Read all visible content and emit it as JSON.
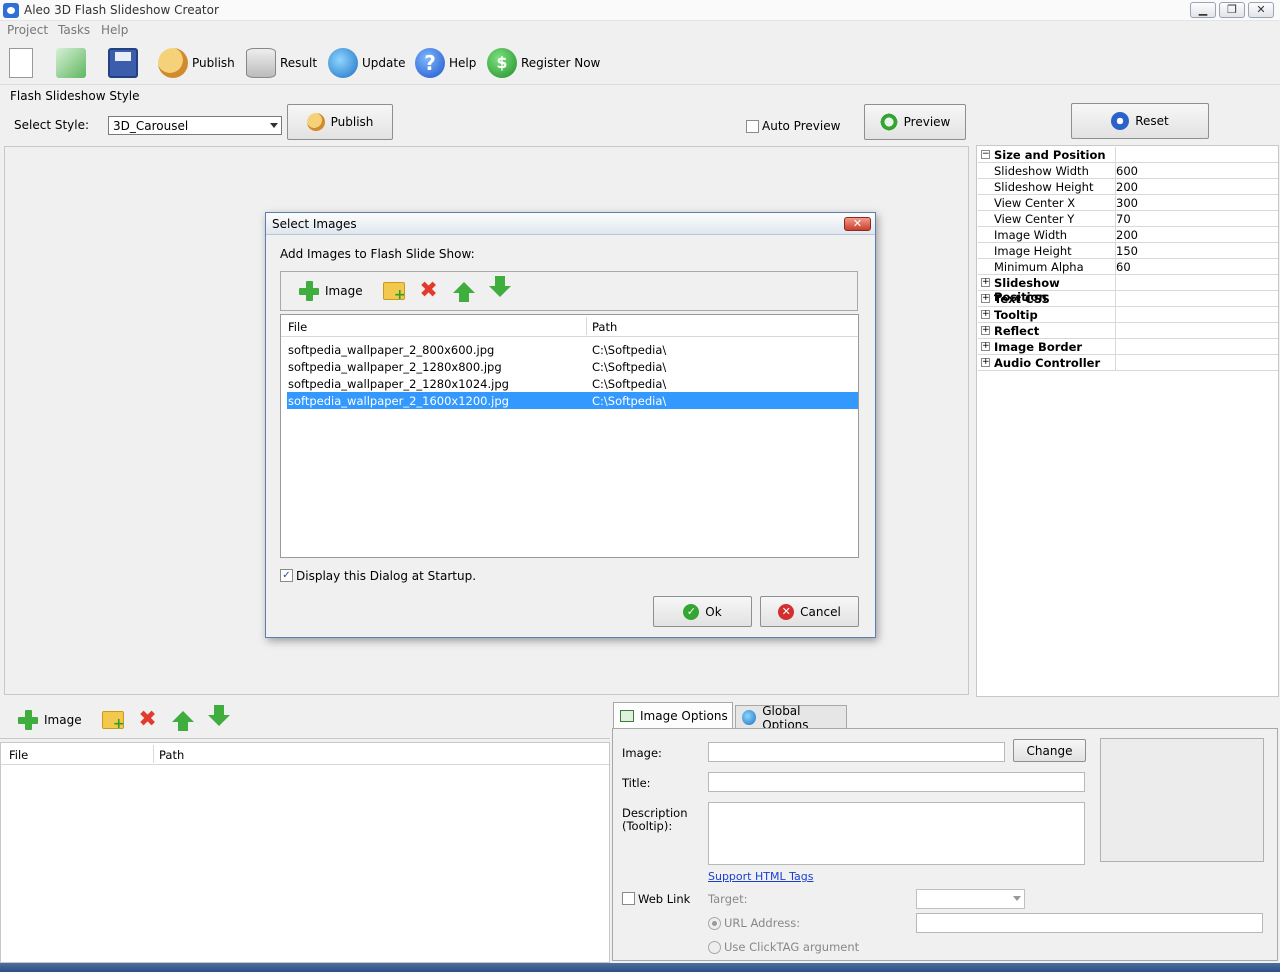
{
  "window": {
    "title": "Aleo 3D Flash Slideshow Creator",
    "min": "▁",
    "max": "❐",
    "close": "✕"
  },
  "menu": [
    "Project",
    "Tasks",
    "Help"
  ],
  "toolbar": {
    "publish": "Publish",
    "result": "Result",
    "update": "Update",
    "help": "Help",
    "register": "Register Now"
  },
  "style_section": {
    "heading": "Flash Slideshow Style",
    "select_label": "Select Style:",
    "select_value": "3D_Carousel",
    "publish_button": "Publish",
    "auto_preview": "Auto Preview",
    "preview_button": "Preview"
  },
  "properties": {
    "reset_button": "Reset",
    "groups": [
      {
        "name": "Size and Position",
        "expanded": true,
        "toggle": "−",
        "items": [
          {
            "key": "Slideshow Width",
            "value": "600"
          },
          {
            "key": "Slideshow Height",
            "value": "200"
          },
          {
            "key": "View Center X",
            "value": "300"
          },
          {
            "key": "View Center Y",
            "value": "70"
          },
          {
            "key": "Image Width",
            "value": "200"
          },
          {
            "key": "Image Height",
            "value": "150"
          },
          {
            "key": "Minimum Alpha",
            "value": "60"
          }
        ]
      },
      {
        "name": "Slideshow Position",
        "toggle": "+"
      },
      {
        "name": "Text CSS",
        "toggle": "+"
      },
      {
        "name": "Tooltip",
        "toggle": "+"
      },
      {
        "name": "Reflect",
        "toggle": "+"
      },
      {
        "name": "Image Border",
        "toggle": "+"
      },
      {
        "name": "Audio Controller",
        "toggle": "+"
      }
    ]
  },
  "dialog": {
    "title": "Select Images",
    "close": "✕",
    "instruction": "Add Images to Flash Slide Show:",
    "add_image": "Image",
    "columns": {
      "file": "File",
      "path": "Path"
    },
    "rows": [
      {
        "file": "softpedia_wallpaper_2_800x600.jpg",
        "path": "C:\\Softpedia\\"
      },
      {
        "file": "softpedia_wallpaper_2_1280x800.jpg",
        "path": "C:\\Softpedia\\"
      },
      {
        "file": "softpedia_wallpaper_2_1280x1024.jpg",
        "path": "C:\\Softpedia\\"
      },
      {
        "file": "softpedia_wallpaper_2_1600x1200.jpg",
        "path": "C:\\Softpedia\\",
        "selected": true
      }
    ],
    "startup_checkbox": "Display this Dialog at Startup.",
    "ok": "Ok",
    "cancel": "Cancel"
  },
  "bottom_left": {
    "add_image": "Image",
    "columns": {
      "file": "File",
      "path": "Path"
    }
  },
  "options": {
    "tab_image": "Image Options",
    "tab_global": "Global Options",
    "image_label": "Image:",
    "change_button": "Change",
    "title_label": "Title:",
    "desc_label_1": "Description",
    "desc_label_2": "(Tooltip):",
    "support_link": "Support HTML Tags",
    "weblink": "Web Link",
    "target_label": "Target:",
    "url_label": "URL Address:",
    "clicktag_label": "Use ClickTAG argument"
  },
  "glyphs": {
    "check": "✓",
    "x": "✖",
    "ok": "✓",
    "cancel": "✕",
    "help": "?",
    "reg": "$"
  }
}
